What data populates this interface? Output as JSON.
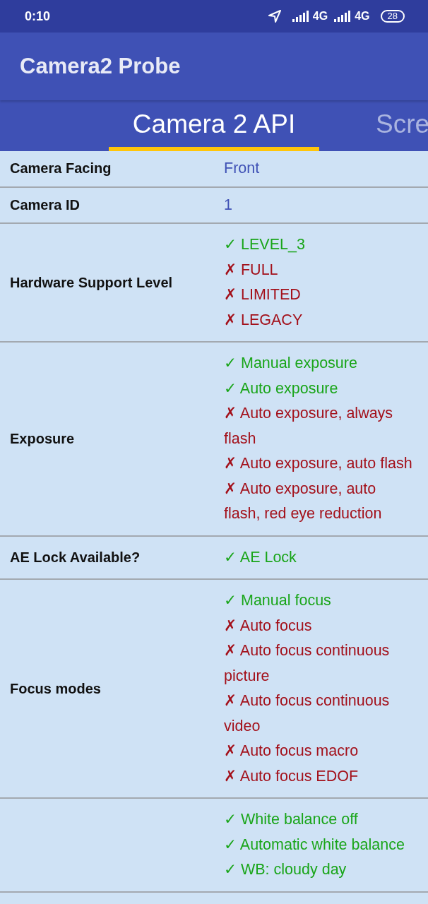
{
  "status_bar": {
    "time": "0:10",
    "network_1": "4G",
    "network_2": "4G",
    "battery": "28"
  },
  "app_bar": {
    "title": "Camera2 Probe"
  },
  "tabs": [
    {
      "label": "Camera 2 API",
      "selected": true
    },
    {
      "label": "Scre",
      "selected": false
    }
  ],
  "rows": [
    {
      "label": "Camera Facing",
      "kind": "text",
      "value": "Front"
    },
    {
      "label": "Camera ID",
      "kind": "text",
      "value": "1"
    },
    {
      "label": "Hardware Support Level",
      "kind": "list",
      "items": [
        {
          "text": "✓ LEVEL_3",
          "supported": true
        },
        {
          "text": "✗ FULL",
          "supported": false
        },
        {
          "text": "✗ LIMITED",
          "supported": false
        },
        {
          "text": "✗ LEGACY",
          "supported": false
        }
      ]
    },
    {
      "label": "Exposure",
      "kind": "list",
      "items": [
        {
          "text": "✓ Manual exposure",
          "supported": true
        },
        {
          "text": "✓ Auto exposure",
          "supported": true
        },
        {
          "text": "✗ Auto exposure, always flash",
          "supported": false
        },
        {
          "text": "✗ Auto exposure, auto flash",
          "supported": false
        },
        {
          "text": "✗ Auto exposure, auto flash, red eye reduction",
          "supported": false
        }
      ]
    },
    {
      "label": "AE Lock Available?",
      "kind": "list",
      "items": [
        {
          "text": "✓ AE Lock",
          "supported": true
        }
      ]
    },
    {
      "label": "Focus modes",
      "kind": "list",
      "items": [
        {
          "text": "✓ Manual focus",
          "supported": true
        },
        {
          "text": "✗ Auto focus",
          "supported": false
        },
        {
          "text": "✗ Auto focus continuous picture",
          "supported": false
        },
        {
          "text": "✗ Auto focus continuous video",
          "supported": false
        },
        {
          "text": "✗ Auto focus macro",
          "supported": false
        },
        {
          "text": "✗ Auto focus EDOF",
          "supported": false
        }
      ]
    },
    {
      "kind": "list",
      "items": [
        {
          "text": "✓ White balance off",
          "supported": true
        },
        {
          "text": "✓ Automatic white balance",
          "supported": true
        },
        {
          "text": "✓ WB: cloudy day",
          "supported": true
        }
      ]
    }
  ]
}
